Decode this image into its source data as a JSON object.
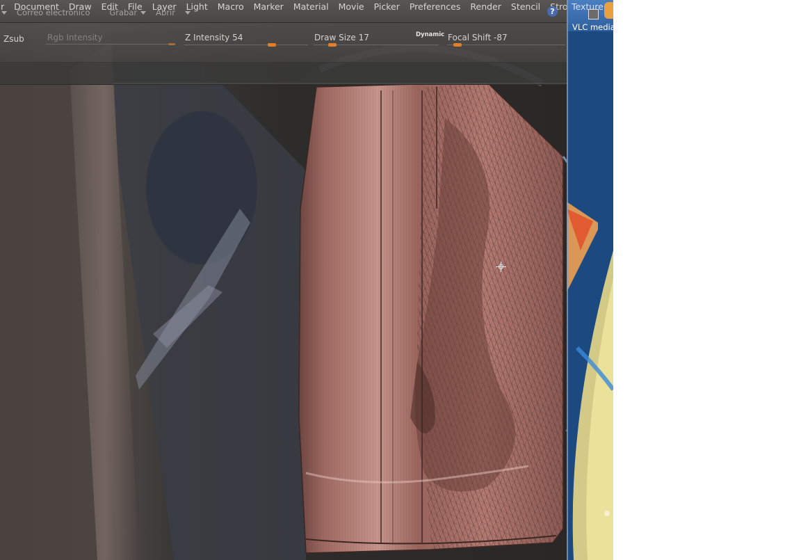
{
  "menubar": {
    "items": [
      "r",
      "Document",
      "Draw",
      "Edit",
      "File",
      "Layer",
      "Light",
      "Macro",
      "Marker",
      "Material",
      "Movie",
      "Picker",
      "Preferences",
      "Render",
      "Stencil",
      "Stroke"
    ],
    "help": "?"
  },
  "mail_overlay": {
    "email_label": "Correo electrónico",
    "record_label": "Grabar",
    "open_label": "Abrir"
  },
  "toolbar": {
    "zsub_label": "Zsub",
    "rgb_intensity_label": "Rgb Intensity",
    "z_intensity_label": "Z Intensity",
    "z_intensity_value": "54",
    "draw_size_label": "Draw Size",
    "draw_size_value": "17",
    "dynamic_label": "Dynamic",
    "focal_shift_label": "Focal Shift",
    "focal_shift_value": "-87"
  },
  "right_panel": {
    "texture_label": "Texture",
    "vlc_label": "VLC media"
  },
  "colors": {
    "accent": "#e07e2a",
    "toolbar_bg": "#4f4d4b",
    "sculpt_skin": "#b07a72",
    "desktop_blue": "#1f4f86"
  }
}
